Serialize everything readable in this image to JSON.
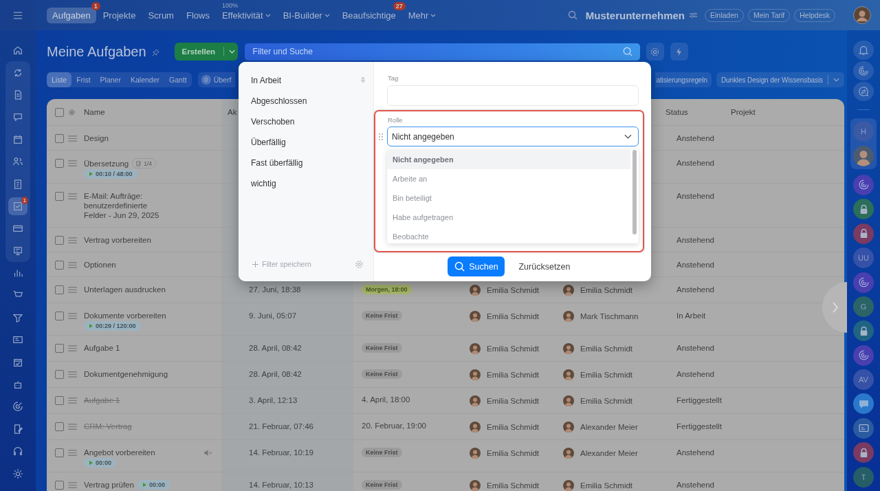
{
  "top_nav": {
    "tabs": [
      {
        "label": "Aufgaben",
        "selected": true,
        "dropdown": false,
        "badge": "1"
      },
      {
        "label": "Projekte",
        "selected": false,
        "dropdown": false
      },
      {
        "label": "Scrum",
        "selected": false,
        "dropdown": false
      },
      {
        "label": "Flows",
        "selected": false,
        "dropdown": false
      },
      {
        "label": "Effektivität",
        "selected": false,
        "dropdown": true,
        "caption": "100%"
      },
      {
        "label": "BI-Builder",
        "selected": false,
        "dropdown": true
      },
      {
        "label": "Beaufsichtige",
        "selected": false,
        "dropdown": false,
        "badge": "27"
      },
      {
        "label": "Mehr",
        "selected": false,
        "dropdown": true
      }
    ],
    "company": "Musterunternehmen",
    "buttons": [
      "Einladen",
      "Mein Tarif",
      "Helpdesk"
    ]
  },
  "left_sidebar": [
    {
      "selected": false
    },
    {
      "selected": false
    },
    {
      "selected": false
    },
    {
      "selected": false
    },
    {
      "selected": false
    },
    {
      "selected": false
    },
    {
      "selected": false
    },
    {
      "selected": true,
      "badge": "1"
    },
    {
      "selected": false
    },
    {
      "selected": false
    },
    {
      "selected": false
    },
    {
      "selected": false
    },
    {
      "selected": false
    },
    {
      "selected": false
    },
    {
      "selected": false
    },
    {
      "selected": false
    },
    {
      "selected": false
    },
    {
      "selected": false
    },
    {
      "selected": false
    },
    {
      "selected": false
    }
  ],
  "toolbar": {
    "title": "Meine Aufgaben",
    "create_button": "Erstellen",
    "search": {
      "placeholder": "Filter und Suche"
    },
    "views": [
      {
        "label": "Liste",
        "selected": true
      },
      {
        "label": "Frist",
        "selected": false
      },
      {
        "label": "Planer",
        "selected": false
      },
      {
        "label": "Kalender",
        "selected": false
      },
      {
        "label": "Gantt",
        "selected": false
      }
    ],
    "counter": {
      "count": "0",
      "label": "Überf"
    },
    "automation_chip": "atisierungsregeln",
    "theme_button": "Dunkles Design der Wissensbasis"
  },
  "table": {
    "header": {
      "checked": false,
      "name": "Name",
      "column_2": "Ak",
      "status": "Status",
      "project": "Projekt"
    },
    "rows": [
      {
        "checked": false,
        "name": "Design",
        "done": false,
        "muted": false,
        "status": "Anstehend"
      },
      {
        "checked": false,
        "name": "Übersetzung",
        "done": false,
        "muted": false,
        "checklist": "1/4",
        "timer": {
          "text": "00:10 / 48:00",
          "inline": false
        },
        "status": "Anstehend"
      },
      {
        "checked": false,
        "name": "E-Mail: Aufträge: benutzerdefinierte Felder - Jun 29, 2025",
        "done": false,
        "muted": false,
        "status": "Anstehend"
      },
      {
        "checked": false,
        "name": "Vertrag vorbereiten",
        "done": false,
        "muted": false,
        "status": "Anstehend"
      },
      {
        "checked": false,
        "name": "Optionen",
        "done": false,
        "muted": false,
        "status": "Anstehend"
      },
      {
        "checked": false,
        "name": "Unterlagen ausdrucken",
        "done": false,
        "muted": false,
        "created": "27. Juni, 18:38",
        "deadline": {
          "text": "Morgen, 18:00",
          "kind": "tag_green"
        },
        "creator": "Emilia Schmidt",
        "responsible": "Emilia Schmidt",
        "status": "Anstehend"
      },
      {
        "checked": false,
        "name": "Dokumente vorbereiten",
        "done": false,
        "muted": false,
        "timer": {
          "text": "00:29 / 120:00",
          "inline": false
        },
        "created": "9. Juni, 05:07",
        "deadline": {
          "text": "Keine Frist",
          "kind": "tag"
        },
        "creator": "Emilia Schmidt",
        "responsible": "Mark Tischmann",
        "status": "In Arbeit"
      },
      {
        "checked": false,
        "name": "Aufgabe 1",
        "done": false,
        "muted": false,
        "created": "28. April, 08:42",
        "deadline": {
          "text": "Keine Frist",
          "kind": "tag"
        },
        "creator": "Emilia Schmidt",
        "responsible": "Emilia Schmidt",
        "status": "Anstehend"
      },
      {
        "checked": false,
        "name": "Dokumentgenehmigung",
        "done": false,
        "muted": false,
        "created": "28. April, 08:42",
        "deadline": {
          "text": "Keine Frist",
          "kind": "tag"
        },
        "creator": "Emilia Schmidt",
        "responsible": "Emilia Schmidt",
        "status": "Anstehend"
      },
      {
        "checked": false,
        "name": "Aufgabe 1",
        "done": true,
        "muted": false,
        "created": "3. April, 12:13",
        "deadline": {
          "text": "4. April, 18:00",
          "kind": "plain"
        },
        "creator": "Emilia Schmidt",
        "responsible": "Emilia Schmidt",
        "status": "Fertiggestellt"
      },
      {
        "checked": false,
        "name": "CRM: Vertrag",
        "done": true,
        "muted": false,
        "created": "21. Februar, 07:46",
        "deadline": {
          "text": "20. Februar, 19:00",
          "kind": "plain"
        },
        "creator": "Emilia Schmidt",
        "responsible": "Alexander Meier",
        "status": "Fertiggestellt"
      },
      {
        "checked": false,
        "name": "Angebot vorbereiten",
        "done": false,
        "muted": true,
        "timer": {
          "text": "00:00",
          "inline": false
        },
        "created": "14. Februar, 10:19",
        "deadline": {
          "text": "Keine Frist",
          "kind": "tag"
        },
        "creator": "Emilia Schmidt",
        "responsible": "Alexander Meier",
        "status": "Anstehend"
      },
      {
        "checked": false,
        "name": "Vertrag prüfen",
        "done": false,
        "muted": false,
        "timer": {
          "text": "00:00",
          "inline": true
        },
        "created": "14. Februar, 10:13",
        "deadline": {
          "text": "Keine Frist",
          "kind": "tag"
        },
        "creator": "Emilia Schmidt",
        "responsible": "Emilia Schmidt",
        "status": "Anstehend"
      }
    ]
  },
  "filter_popup": {
    "presets": [
      {
        "label": "In Arbeit",
        "pinned": true
      },
      {
        "label": "Abgeschlossen",
        "pinned": false
      },
      {
        "label": "Verschoben",
        "pinned": false
      },
      {
        "label": "Überfällig",
        "pinned": false
      },
      {
        "label": "Fast überfällig",
        "pinned": false
      },
      {
        "label": "wichtig",
        "pinned": false
      }
    ],
    "save_filter": "Filter speichern",
    "tag": {
      "label": "Tag"
    },
    "role": {
      "label": "Rolle",
      "value": "Nicht angegeben",
      "highlighted": true,
      "options": [
        {
          "label": "Nicht angegeben",
          "selected": true
        },
        {
          "label": "Arbeite an",
          "selected": false
        },
        {
          "label": "Bin beteiligt",
          "selected": false
        },
        {
          "label": "Habe aufgetragen",
          "selected": false
        },
        {
          "label": "Beobachte",
          "selected": false
        }
      ]
    },
    "search_button": "Suchen",
    "reset_button": "Zurücksetzen"
  },
  "right_sidebar": {
    "tools": [
      {
        "kind": "bell"
      },
      {
        "kind": "swirl"
      },
      {
        "kind": "chat"
      }
    ],
    "pinned": [
      {
        "kind": "initials",
        "text": "H",
        "color": "#3a5aa6"
      },
      {
        "kind": "avatar"
      }
    ],
    "chats": [
      {
        "kind": "swirl",
        "color": "#4a3fb0"
      },
      {
        "kind": "lock",
        "color": "#2b6e5a"
      },
      {
        "kind": "lock",
        "color": "#7a3a62"
      },
      {
        "kind": "initials",
        "text": "UU",
        "color": "#3552a8"
      },
      {
        "kind": "swirl",
        "color": "#4a3fb0"
      },
      {
        "kind": "initials",
        "text": "G",
        "color": "#2a6466"
      },
      {
        "kind": "lock",
        "color": "#1f6482"
      },
      {
        "kind": "swirl",
        "color": "#4a3fb0"
      },
      {
        "kind": "initials",
        "text": "AV",
        "color": "#3552a8"
      },
      {
        "kind": "chat",
        "color": "#2a78cc"
      },
      {
        "kind": "card",
        "color": "#2a5aa0"
      },
      {
        "kind": "lock",
        "color": "#7a3a62"
      },
      {
        "kind": "initials",
        "text": "T",
        "color": "#255e66"
      }
    ]
  }
}
